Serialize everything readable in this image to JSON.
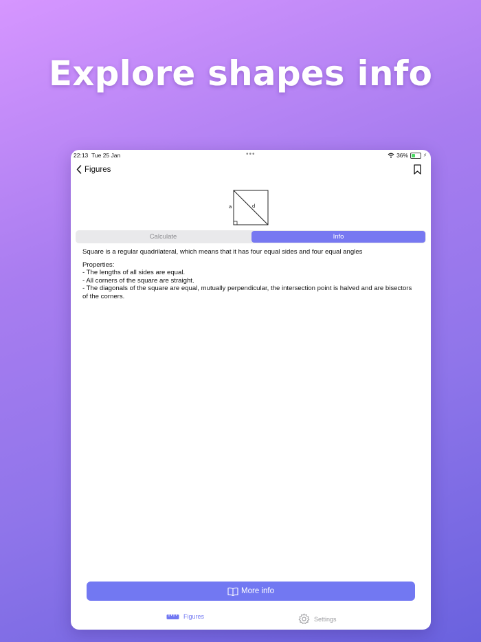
{
  "headline": "Explore shapes info",
  "status": {
    "time": "22:13",
    "date": "Tue 25 Jan",
    "battery": "36%",
    "battery_level": 0.36
  },
  "nav": {
    "back_label": "Figures"
  },
  "figure": {
    "side_label": "a",
    "diagonal_label": "d"
  },
  "segments": {
    "calculate": "Calculate",
    "info": "Info",
    "selected": "Info"
  },
  "info": {
    "intro": "Square is a regular quadrilateral, which means that it has four equal sides and four equal angles",
    "properties_title": "Properties:",
    "properties": [
      "- The lengths of all sides are equal.",
      "- All corners of the square are straight.",
      "- The diagonals of the square are equal, mutually perpendicular, the intersection point is halved and are bisectors of the corners."
    ]
  },
  "more_button": {
    "label": "More info",
    "icon": "book-icon"
  },
  "tabbar": {
    "figures": "Figures",
    "settings": "Settings",
    "active": "Figures"
  },
  "colors": {
    "accent": "#7278f2",
    "background_top": "#d696ff",
    "background_bottom": "#6a62de"
  }
}
